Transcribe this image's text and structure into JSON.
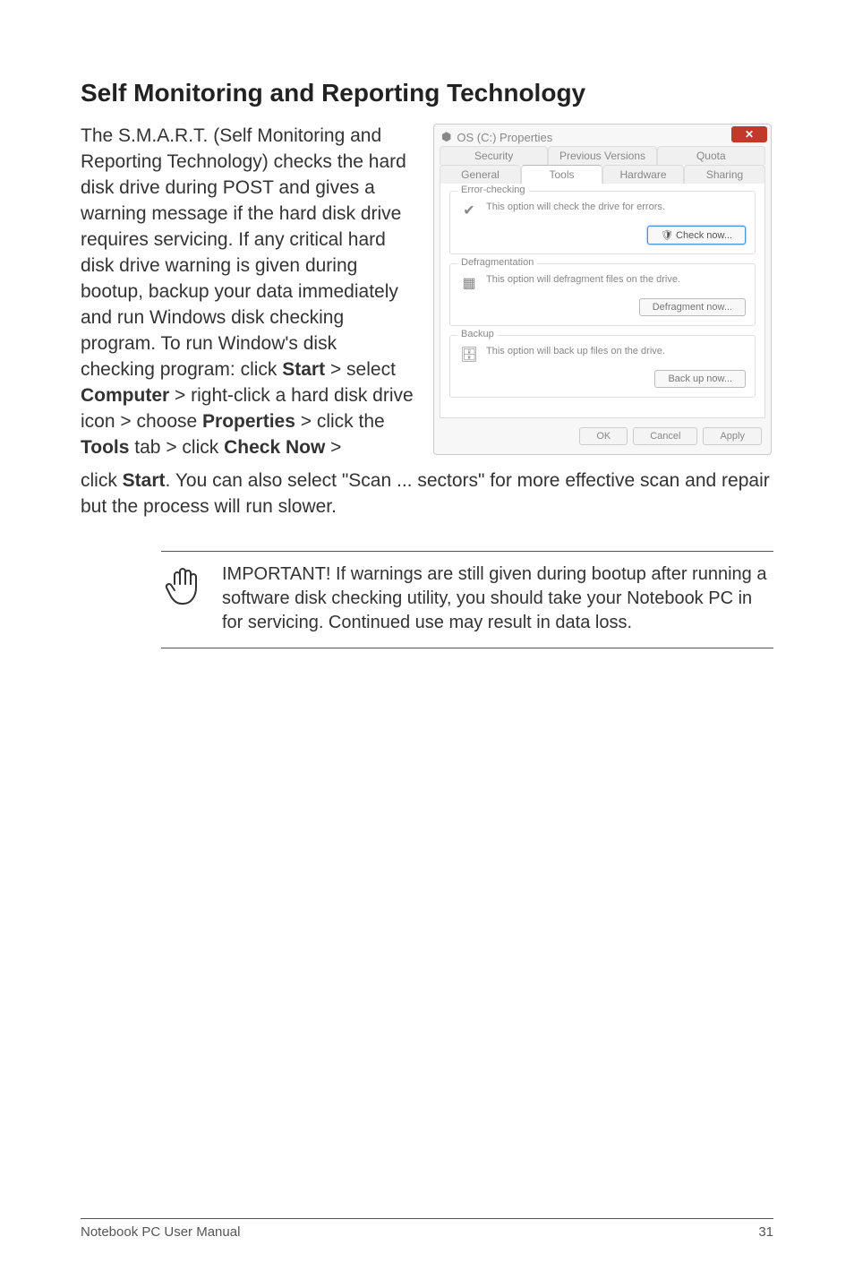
{
  "heading": "Self Monitoring and Reporting Technology",
  "upper_text_parts": [
    {
      "t": "The S.M.A.R.T. (Self Monitoring and Reporting Technology) checks the hard disk drive during POST and gives a warning message if the hard disk drive requires servicing. If any critical hard disk drive warning is given during bootup, backup your data immediately and run Windows disk checking program. To run Window's disk checking program: click ",
      "b": false
    },
    {
      "t": "Start",
      "b": true
    },
    {
      "t": " > select ",
      "b": false
    },
    {
      "t": "Computer",
      "b": true
    },
    {
      "t": " > right-click a hard disk drive icon > choose ",
      "b": false
    },
    {
      "t": "Properties",
      "b": true
    },
    {
      "t": " > click the ",
      "b": false
    },
    {
      "t": "Tools",
      "b": true
    },
    {
      "t": " tab > click ",
      "b": false
    },
    {
      "t": "Check Now",
      "b": true
    },
    {
      "t": " > ",
      "b": false
    }
  ],
  "lower_text_parts": [
    {
      "t": "click ",
      "b": false
    },
    {
      "t": "Start",
      "b": true
    },
    {
      "t": ". You can also select \"Scan ... sectors\" for more effective scan and repair but the process will run slower.",
      "b": false
    }
  ],
  "note_text": "IMPORTANT! If warnings are still given during bootup after running a software disk checking utility, you should take your Notebook PC in for servicing. Continued use may result in data loss.",
  "dialog": {
    "title_icon": "⬢",
    "title": "OS (C:) Properties",
    "tabs_row1": [
      "Security",
      "Previous Versions",
      "Quota"
    ],
    "tabs_row2": [
      "General",
      "Tools",
      "Hardware",
      "Sharing"
    ],
    "active_tab": "Tools",
    "groups": [
      {
        "title": "Error-checking",
        "icon": "✔",
        "text": "This option will check the drive for errors.",
        "button": "Check now...",
        "highlight": true,
        "shield": true
      },
      {
        "title": "Defragmentation",
        "icon": "▦",
        "text": "This option will defragment files on the drive.",
        "button": "Defragment now...",
        "highlight": false,
        "shield": false
      },
      {
        "title": "Backup",
        "icon": "🗄",
        "text": "This option will back up files on the drive.",
        "button": "Back up now...",
        "highlight": false,
        "shield": false
      }
    ],
    "buttons": [
      "OK",
      "Cancel",
      "Apply"
    ]
  },
  "footer": {
    "left": "Notebook PC User Manual",
    "right": "31"
  }
}
